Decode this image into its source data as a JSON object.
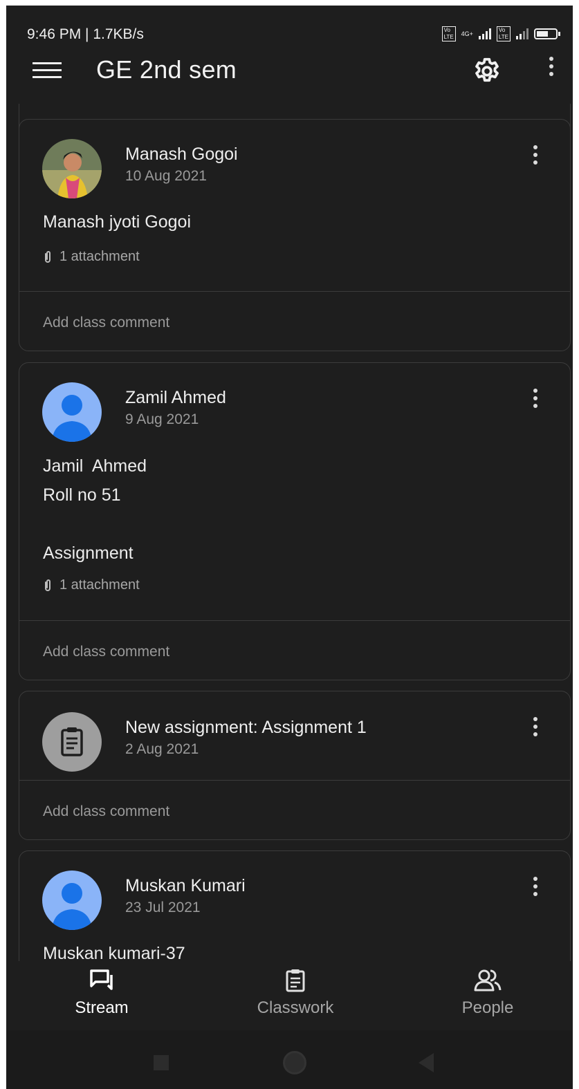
{
  "status_bar": {
    "time": "9:46 PM | 1.7KB/s",
    "network": "4G+"
  },
  "app_bar": {
    "title": "GE 2nd sem"
  },
  "posts": [
    {
      "author": "Manash Gogoi",
      "date": "10 Aug 2021",
      "body": "Manash jyoti Gogoi",
      "attachment": "1 attachment",
      "comment_placeholder": "Add class comment"
    },
    {
      "author": "Zamil Ahmed",
      "date": "9 Aug 2021",
      "body": "Jamil  Ahmed\nRoll no 51\n\nAssignment",
      "attachment": "1 attachment",
      "comment_placeholder": "Add class comment"
    },
    {
      "author": "New assignment: Assignment 1",
      "date": "2 Aug 2021",
      "comment_placeholder": "Add class comment"
    },
    {
      "author": "Muskan Kumari",
      "date": "23 Jul 2021",
      "body": "Muskan kumari-37"
    }
  ],
  "bottom_nav": {
    "items": [
      {
        "label": "Stream",
        "active": true
      },
      {
        "label": "Classwork",
        "active": false
      },
      {
        "label": "People",
        "active": false
      }
    ]
  },
  "colors": {
    "active_nav": "#ffffff",
    "inactive_nav": "#a6a6a6",
    "avatar_blue": "#8ab4f8"
  }
}
